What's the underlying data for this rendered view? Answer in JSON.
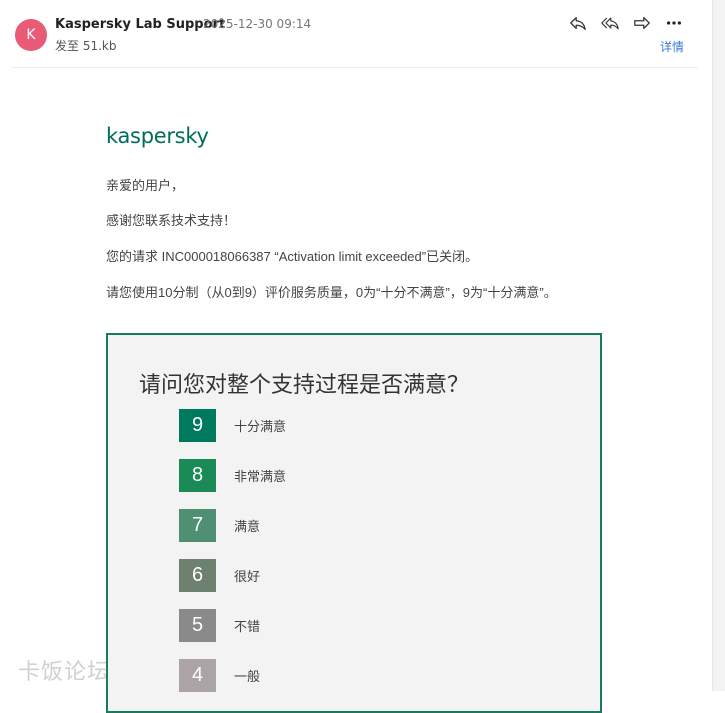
{
  "header": {
    "avatar_letter": "K",
    "sender": "Kaspersky Lab Support",
    "time": "2025-12-30 09:14",
    "to_line": "发至 51.kb",
    "details": "详情"
  },
  "email": {
    "logo": "kaspersky",
    "greeting": "亲爱的用户，",
    "thanks": "感谢您联系技术支持！",
    "request_status": "您的请求 INC000018066387 “Activation limit exceeded”已关闭。",
    "instructions": "请您使用10分制（从0到9）评价服务质量，0为“十分不满意”，9为“十分满意”。"
  },
  "survey": {
    "question": "请问您对整个支持过程是否满意？",
    "ratings": [
      {
        "value": "9",
        "label": "十分满意",
        "color": "#007a5e"
      },
      {
        "value": "8",
        "label": "非常满意",
        "color": "#1a8a56"
      },
      {
        "value": "7",
        "label": "满意",
        "color": "#4f8f72"
      },
      {
        "value": "6",
        "label": "很好",
        "color": "#6e8070"
      },
      {
        "value": "5",
        "label": "不错",
        "color": "#8a8a8a"
      },
      {
        "value": "4",
        "label": "一般",
        "color": "#aba3a6"
      }
    ]
  },
  "watermark": "卡饭论坛"
}
